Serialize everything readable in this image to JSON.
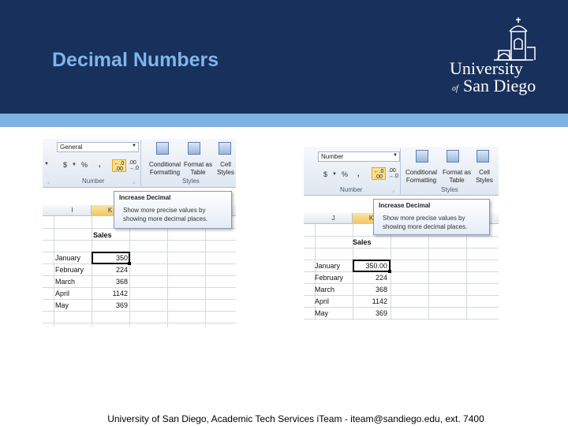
{
  "slide": {
    "title": "Decimal Numbers",
    "footer": "University of San Diego, Academic Tech Services iTeam - iteam@sandiego.edu, ext. 7400"
  },
  "logo": {
    "line1": "University",
    "of": "of",
    "line2": "San Diego"
  },
  "colors": {
    "header": "#18305c",
    "stripe": "#7fb1e0",
    "title": "#7eb6ea",
    "highlight": "#fce08a"
  },
  "before": {
    "number_format": "General",
    "currency_symbol": "$",
    "percent_symbol": "%",
    "comma_symbol": ",",
    "inc_decimal_icon": "←.0 .00",
    "dec_decimal_icon": ".00 →.0",
    "number_group_label": "Number",
    "styles": {
      "conditional": "Conditional Formatting",
      "format_as": "Format as Table",
      "cell": "Cell Styles",
      "group_label": "Styles"
    },
    "columns": [
      "I",
      "K"
    ],
    "tooltip": {
      "title": "Increase Decimal",
      "body_line1": "Show more precise values by",
      "body_line2": "showing more decimal places."
    },
    "header": "Sales",
    "rows": [
      {
        "month": "January",
        "value": "350"
      },
      {
        "month": "February",
        "value": "224"
      },
      {
        "month": "March",
        "value": "368"
      },
      {
        "month": "April",
        "value": "1142"
      },
      {
        "month": "May",
        "value": "369"
      }
    ]
  },
  "after": {
    "number_format": "Number",
    "currency_symbol": "$",
    "percent_symbol": "%",
    "comma_symbol": ",",
    "inc_decimal_icon": "←.0 .00",
    "dec_decimal_icon": ".00 →.0",
    "number_group_label": "Number",
    "styles": {
      "conditional": "Conditional Formatting",
      "format_as": "Format as Table",
      "cell": "Cell Styles",
      "group_label": "Styles"
    },
    "columns": [
      "J",
      "K"
    ],
    "tooltip": {
      "title": "Increase Decimal",
      "body_line1": "Show more precise values by",
      "body_line2": "showing more decimal places."
    },
    "header": "Sales",
    "rows": [
      {
        "month": "January",
        "value": "350.00"
      },
      {
        "month": "February",
        "value": "224"
      },
      {
        "month": "March",
        "value": "368"
      },
      {
        "month": "April",
        "value": "1142"
      },
      {
        "month": "May",
        "value": "369"
      }
    ]
  }
}
